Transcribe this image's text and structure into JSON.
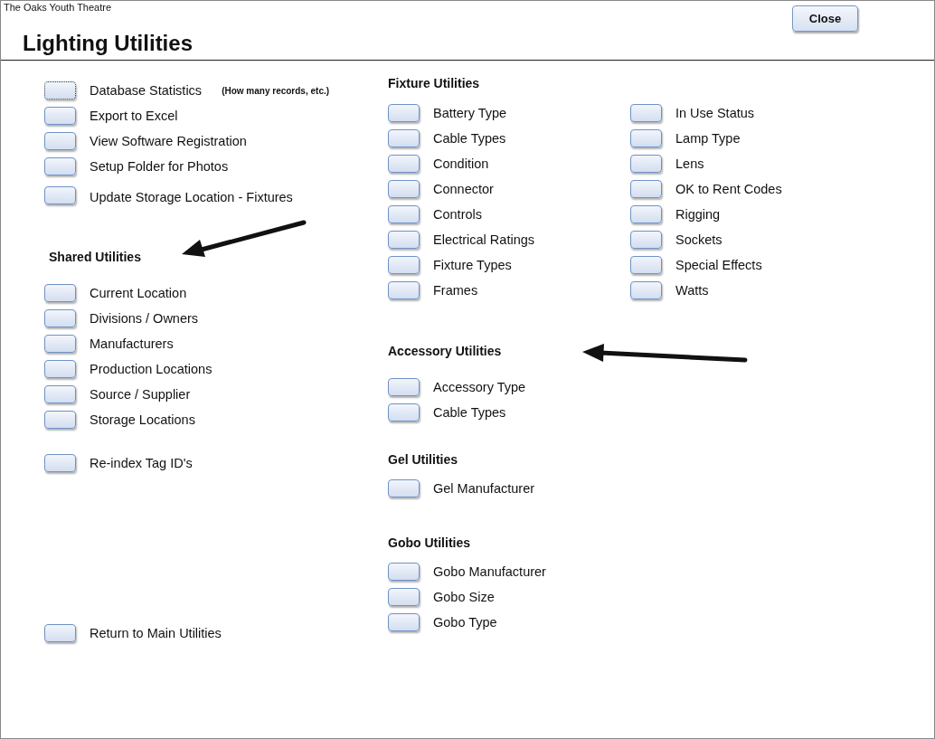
{
  "app_title": "The Oaks Youth Theatre",
  "title": "Lighting Utilities",
  "close_button": "Close",
  "general_items": [
    {
      "label": "Database Statistics",
      "note": "(How many records, etc.)",
      "focused": true
    },
    {
      "label": "Export to Excel",
      "focused": false
    },
    {
      "label": "View Software Registration",
      "focused": false
    },
    {
      "label": "Setup Folder for Photos",
      "focused": false
    },
    {
      "label": "Update Storage Location - Fixtures",
      "focused": false
    }
  ],
  "shared_utilities": {
    "heading": "Shared Utilities",
    "items": [
      "Current Location",
      "Divisions / Owners",
      "Manufacturers",
      "Production Locations",
      "Source / Supplier",
      "Storage Locations"
    ]
  },
  "reindex": "Re-index Tag ID's",
  "return": "Return to Main Utilities",
  "fixture_utilities": {
    "heading": "Fixture Utilities",
    "column_1": [
      "Battery Type",
      "Cable Types",
      "Condition",
      "Connector",
      "Controls",
      "Electrical Ratings",
      "Fixture Types",
      "Frames"
    ],
    "column_2": [
      "In Use Status",
      "Lamp Type",
      "Lens",
      "OK to Rent Codes",
      "Rigging",
      "Sockets",
      "Special Effects",
      "Watts"
    ]
  },
  "accessory_utilities": {
    "heading": "Accessory Utilities",
    "items": [
      "Accessory Type",
      "Cable Types"
    ]
  },
  "gel_utilities": {
    "heading": "Gel Utilities",
    "items": [
      "Gel Manufacturer"
    ]
  },
  "gobo_utilities": {
    "heading": "Gobo Utilities",
    "items": [
      "Gobo Manufacturer",
      "Gobo Size",
      "Gobo Type"
    ]
  }
}
